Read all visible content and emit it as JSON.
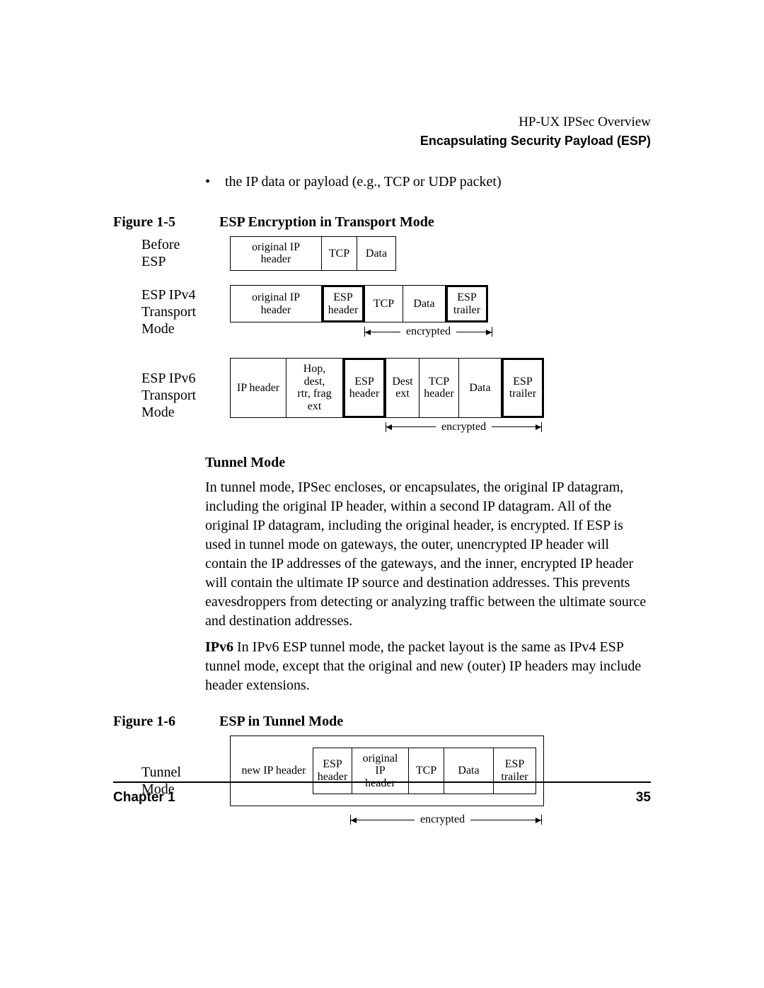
{
  "header": {
    "doc_title": "HP-UX IPSec Overview",
    "section_title": "Encapsulating Security Payload (ESP)"
  },
  "bullet": "the IP data or payload (e.g., TCP or UDP packet)",
  "figure_1_5": {
    "number": "Figure 1-5",
    "title": "ESP Encryption in Transport Mode",
    "rows": {
      "before": {
        "label_line1": "Before",
        "label_line2": "ESP",
        "boxes": [
          "original IP header",
          "TCP",
          "Data"
        ]
      },
      "ipv4": {
        "label_line1": "ESP IPv4",
        "label_line2": "Transport",
        "label_line3": "Mode",
        "boxes": [
          "original IP header",
          "ESP\nheader",
          "TCP",
          "Data",
          "ESP\ntrailer"
        ],
        "encrypted_label": "encrypted"
      },
      "ipv6": {
        "label_line1": "ESP IPv6",
        "label_line2": "Transport",
        "label_line3": "Mode",
        "boxes": [
          "IP header",
          "Hop, dest,\nrtr, frag ext",
          "ESP\nheader",
          "Dest\next",
          "TCP\nheader",
          "Data",
          "ESP\ntrailer"
        ],
        "encrypted_label": "encrypted"
      }
    }
  },
  "tunnel_mode": {
    "heading": "Tunnel Mode",
    "paragraph": "In tunnel mode, IPSec encloses, or encapsulates, the original IP datagram, including the original IP header, within a second IP datagram. All of the original IP datagram, including the original header, is encrypted. If ESP is used in tunnel mode on gateways, the outer, unencrypted IP header will contain the IP addresses of the gateways, and the inner, encrypted IP header will contain the ultimate IP source and destination addresses. This prevents eavesdroppers from detecting or analyzing traffic between the ultimate source and destination addresses.",
    "ipv6_prefix": "IPv6",
    "ipv6_para": "  In IPv6 ESP tunnel mode, the packet layout is the same as IPv4 ESP tunnel mode, except that the original and new (outer) IP headers may include header extensions."
  },
  "figure_1_6": {
    "number": "Figure 1-6",
    "title": "ESP in Tunnel Mode",
    "label_line1": "Tunnel",
    "label_line2": "Mode",
    "boxes": [
      "new IP header",
      "ESP\nheader",
      "original IP\nheader",
      "TCP",
      "Data",
      "ESP\ntrailer"
    ],
    "encrypted_label": "encrypted"
  },
  "footer": {
    "chapter": "Chapter 1",
    "page": "35"
  }
}
